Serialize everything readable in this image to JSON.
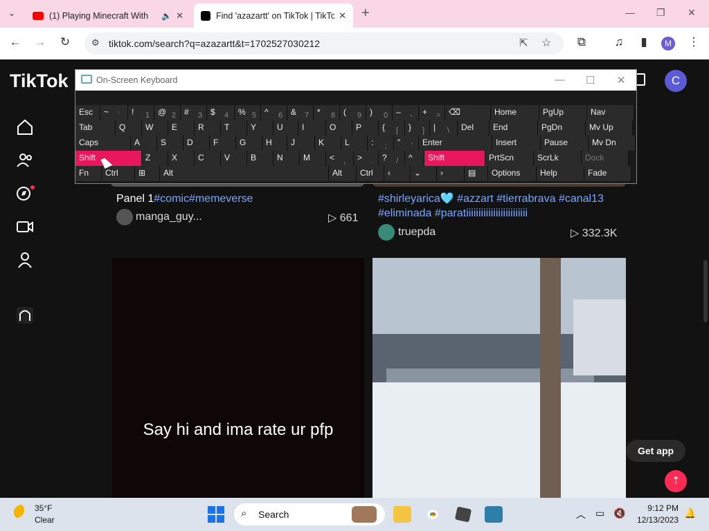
{
  "browser": {
    "tabs": [
      {
        "title": "(1) Playing Minecraft With",
        "close": "✕"
      },
      {
        "title": "Find 'azazartt' on TikTok | TikTok",
        "close": "✕"
      }
    ],
    "new_tab": "+",
    "url": "tiktok.com/search?q=azazartt&t=1702527030212",
    "profile_initial": "M"
  },
  "tiktok": {
    "logo": "TikTok",
    "avatar_initial": "C",
    "results": [
      {
        "title_plain": "Panel 1",
        "title_tags": "#comic#memeverse",
        "author": "manga_guy...",
        "views": "661"
      },
      {
        "title_tags": "#shirleyarica🩵 #azzart #tierrabrava #canal13 #eliminada #paratiiiiiiiiiiiiiiiiiiiiiiiii",
        "author": "truepda",
        "views": "332.3K"
      }
    ],
    "video_caption": "Say hi and ima rate ur pfp",
    "get_app": "Get app"
  },
  "osk": {
    "title": "On-Screen Keyboard",
    "rows": [
      [
        {
          "l": "Esc",
          "w": 36
        },
        {
          "l": "~",
          "s": "`",
          "w": 40
        },
        {
          "l": "!",
          "s": "1",
          "w": 38
        },
        {
          "l": "@",
          "s": "2",
          "w": 38
        },
        {
          "l": "#",
          "s": "3",
          "w": 38
        },
        {
          "l": "$",
          "s": "4",
          "w": 40
        },
        {
          "l": "%",
          "s": "5",
          "w": 38
        },
        {
          "l": "^",
          "s": "6",
          "w": 38
        },
        {
          "l": "&",
          "s": "7",
          "w": 38
        },
        {
          "l": "*",
          "s": "8",
          "w": 38
        },
        {
          "l": "(",
          "s": "9",
          "w": 38
        },
        {
          "l": ")",
          "s": "0",
          "w": 38
        },
        {
          "l": "–",
          "s": "-",
          "w": 38
        },
        {
          "l": "+",
          "s": "=",
          "w": 38
        },
        {
          "l": "⌫",
          "w": 66
        },
        {
          "l": "Home",
          "w": 70
        },
        {
          "l": "PgUp",
          "w": 69
        },
        {
          "l": "Nav",
          "w": 68
        }
      ],
      [
        {
          "l": "Tab",
          "w": 58
        },
        {
          "l": "Q",
          "w": 38
        },
        {
          "l": "W",
          "w": 38
        },
        {
          "l": "E",
          "w": 38
        },
        {
          "l": "R",
          "w": 38
        },
        {
          "l": "T",
          "w": 38
        },
        {
          "l": "Y",
          "w": 38
        },
        {
          "l": "U",
          "w": 36
        },
        {
          "l": "I",
          "w": 40
        },
        {
          "l": "O",
          "w": 38
        },
        {
          "l": "P",
          "w": 38
        },
        {
          "l": "{",
          "s": "[",
          "w": 38
        },
        {
          "l": "}",
          "s": "]",
          "w": 36
        },
        {
          "l": "|",
          "s": "\\",
          "w": 40
        },
        {
          "l": "Del",
          "w": 46
        },
        {
          "l": "End",
          "w": 70
        },
        {
          "l": "PgDn",
          "w": 69
        },
        {
          "l": "Mv Up",
          "w": 68
        }
      ],
      [
        {
          "l": "Caps",
          "w": 80
        },
        {
          "l": "A",
          "w": 38
        },
        {
          "l": "S",
          "w": 38
        },
        {
          "l": "D",
          "w": 38
        },
        {
          "l": "F",
          "w": 38
        },
        {
          "l": "G",
          "w": 38
        },
        {
          "l": "H",
          "w": 36
        },
        {
          "l": "J",
          "w": 40
        },
        {
          "l": "K",
          "w": 38
        },
        {
          "l": "L",
          "w": 38
        },
        {
          "l": ":",
          "s": ";",
          "w": 38
        },
        {
          "l": "\"",
          "s": "'",
          "w": 36
        },
        {
          "l": "Enter",
          "w": 106
        },
        {
          "l": "Insert",
          "w": 70
        },
        {
          "l": "Pause",
          "w": 69
        },
        {
          "l": "Mv Dn",
          "w": 68
        }
      ],
      [
        {
          "l": "Shift",
          "w": 96,
          "pink": true
        },
        {
          "l": "Z",
          "w": 38
        },
        {
          "l": "X",
          "w": 38
        },
        {
          "l": "C",
          "w": 38
        },
        {
          "l": "V",
          "w": 38
        },
        {
          "l": "B",
          "w": 38
        },
        {
          "l": "N",
          "w": 38
        },
        {
          "l": "M",
          "w": 38
        },
        {
          "l": "<",
          "s": ",",
          "w": 40
        },
        {
          "l": ">",
          "s": ".",
          "w": 36
        },
        {
          "l": "?",
          "s": "/",
          "w": 38
        },
        {
          "l": "^",
          "w": 28
        },
        {
          "l": "Shift",
          "w": 88,
          "pink": true
        },
        {
          "l": "PrtScn",
          "w": 70
        },
        {
          "l": "ScrLk",
          "w": 69
        },
        {
          "l": "Dock",
          "w": 68,
          "dim": true
        }
      ],
      [
        {
          "l": "Fn",
          "w": 38
        },
        {
          "l": "Ctrl",
          "w": 48
        },
        {
          "l": "⊞",
          "w": 36
        },
        {
          "l": "Alt",
          "w": 244
        },
        {
          "l": "Alt",
          "w": 40
        },
        {
          "l": "Ctrl",
          "w": 40
        },
        {
          "l": "‹",
          "w": 38
        },
        {
          "l": "⌄",
          "w": 38
        },
        {
          "l": "›",
          "w": 40
        },
        {
          "l": "▤",
          "w": 34
        },
        {
          "l": "Options",
          "w": 70
        },
        {
          "l": "Help",
          "w": 69
        },
        {
          "l": "Fade",
          "w": 68
        }
      ]
    ]
  },
  "taskbar": {
    "temperature": "35°F",
    "condition": "Clear",
    "search_label": "Search",
    "time": "9:12 PM",
    "date": "12/13/2023"
  }
}
